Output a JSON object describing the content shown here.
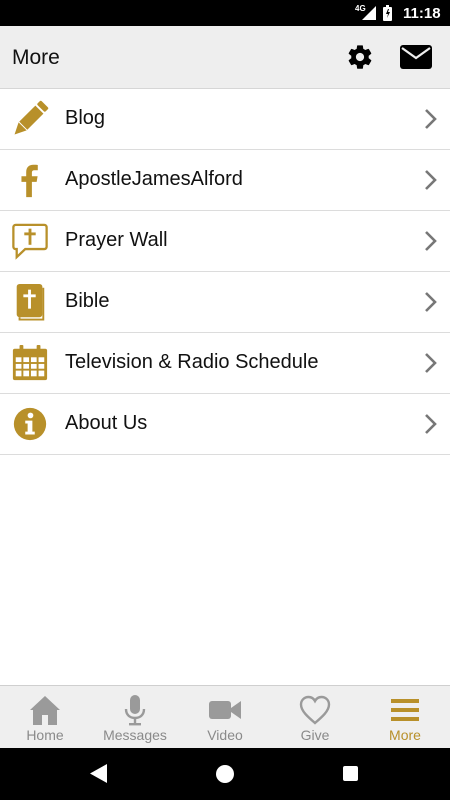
{
  "status_bar": {
    "network": "4G",
    "time": "11:18"
  },
  "header": {
    "title": "More"
  },
  "menu": {
    "items": [
      {
        "label": "Blog",
        "icon": "pencil-icon"
      },
      {
        "label": "ApostleJamesAlford",
        "icon": "facebook-icon"
      },
      {
        "label": "Prayer Wall",
        "icon": "speech-cross-icon"
      },
      {
        "label": "Bible",
        "icon": "bible-icon"
      },
      {
        "label": "Television & Radio Schedule",
        "icon": "calendar-icon"
      },
      {
        "label": "About Us",
        "icon": "info-icon"
      }
    ]
  },
  "tabs": [
    {
      "label": "Home",
      "icon": "home-icon"
    },
    {
      "label": "Messages",
      "icon": "microphone-icon"
    },
    {
      "label": "Video",
      "icon": "video-camera-icon"
    },
    {
      "label": "Give",
      "icon": "heart-icon"
    },
    {
      "label": "More",
      "icon": "menu-icon",
      "active": true
    }
  ],
  "colors": {
    "accent": "#b8902a",
    "inactive": "#8a8a8a",
    "app_bar": "#eeeeee"
  }
}
